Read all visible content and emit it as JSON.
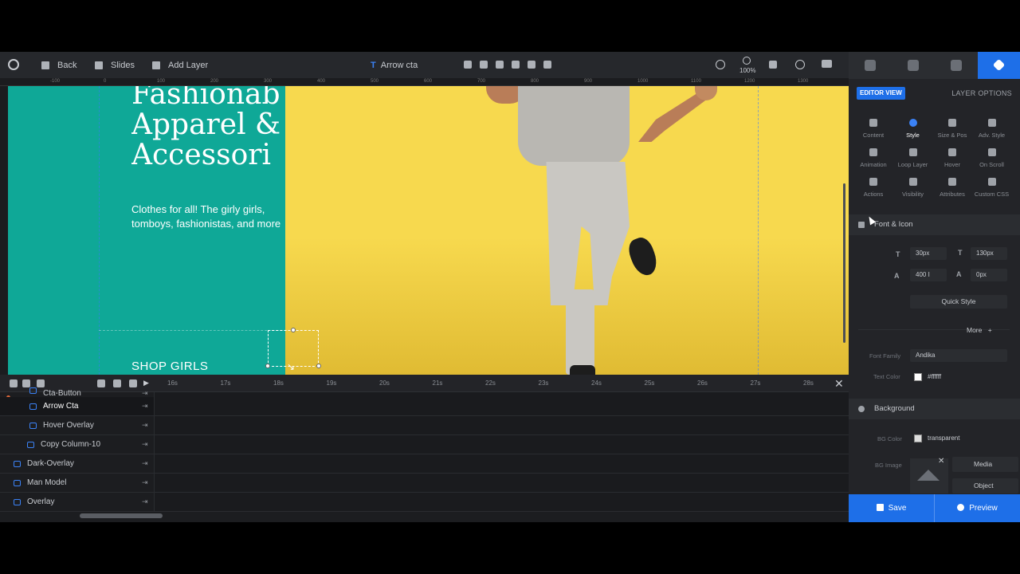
{
  "toolbar": {
    "back_label": "Back",
    "slides_label": "Slides",
    "add_layer_label": "Add Layer",
    "current_layer": "Arrow cta",
    "zoom": "100%"
  },
  "ruler": {
    "ticks": [
      "-100",
      "0",
      "100",
      "200",
      "300",
      "400",
      "500",
      "600",
      "700",
      "800",
      "900",
      "1000",
      "1100",
      "1200",
      "1300"
    ]
  },
  "canvas": {
    "headline": "Fashionab\nApparel &\nAccessori",
    "subtext": "Clothes for all! The girly girls, tomboys, fashionistas, and more",
    "cta": "SHOP GIRLS",
    "arrow_glyph": "↘"
  },
  "timeline": {
    "ticks": [
      "16s",
      "17s",
      "18s",
      "19s",
      "20s",
      "21s",
      "22s",
      "23s",
      "24s",
      "25s",
      "26s",
      "27s",
      "28s"
    ],
    "layers": [
      {
        "name": "Cta-Button",
        "indent": 54
      },
      {
        "name": "Arrow Cta",
        "indent": 54
      },
      {
        "name": "Hover Overlay",
        "indent": 54
      },
      {
        "name": "Copy Column-10",
        "indent": 51
      },
      {
        "name": "Dark-Overlay",
        "indent": 34
      },
      {
        "name": "Man Model",
        "indent": 34
      },
      {
        "name": "Overlay",
        "indent": 34
      }
    ],
    "close_glyph": "✕",
    "pin_glyph": "⇥"
  },
  "panel": {
    "editor_view": "EDITOR VIEW",
    "layer_options": "LAYER OPTIONS",
    "options": [
      {
        "label": "Content"
      },
      {
        "label": "Style"
      },
      {
        "label": "Size & Pos"
      },
      {
        "label": "Adv. Style"
      },
      {
        "label": "Animation"
      },
      {
        "label": "Loop Layer"
      },
      {
        "label": "Hover"
      },
      {
        "label": "On Scroll"
      },
      {
        "label": "Actions"
      },
      {
        "label": "Visibility"
      },
      {
        "label": "Attributes"
      },
      {
        "label": "Custom CSS"
      }
    ],
    "font_icon": {
      "title": "Font & Icon",
      "font_size": "30px",
      "line_height": "130px",
      "font_weight": "400 I",
      "letter_spacing": "0px",
      "quick_style": "Quick Style",
      "more": "More",
      "more_glyph": "+",
      "font_family_label": "Font Family",
      "font_family": "Andika",
      "text_color_label": "Text Color",
      "text_color": "#ffffff"
    },
    "background": {
      "title": "Background",
      "bg_color_label": "BG Color",
      "bg_color": "transparent",
      "bg_image_label": "BG Image",
      "media": "Media",
      "object": "Object"
    }
  },
  "footer": {
    "save": "Save",
    "preview": "Preview"
  },
  "colors": {
    "accent": "#1e6fe8",
    "teal": "#0fa897",
    "yellow": "#f7d94e"
  }
}
